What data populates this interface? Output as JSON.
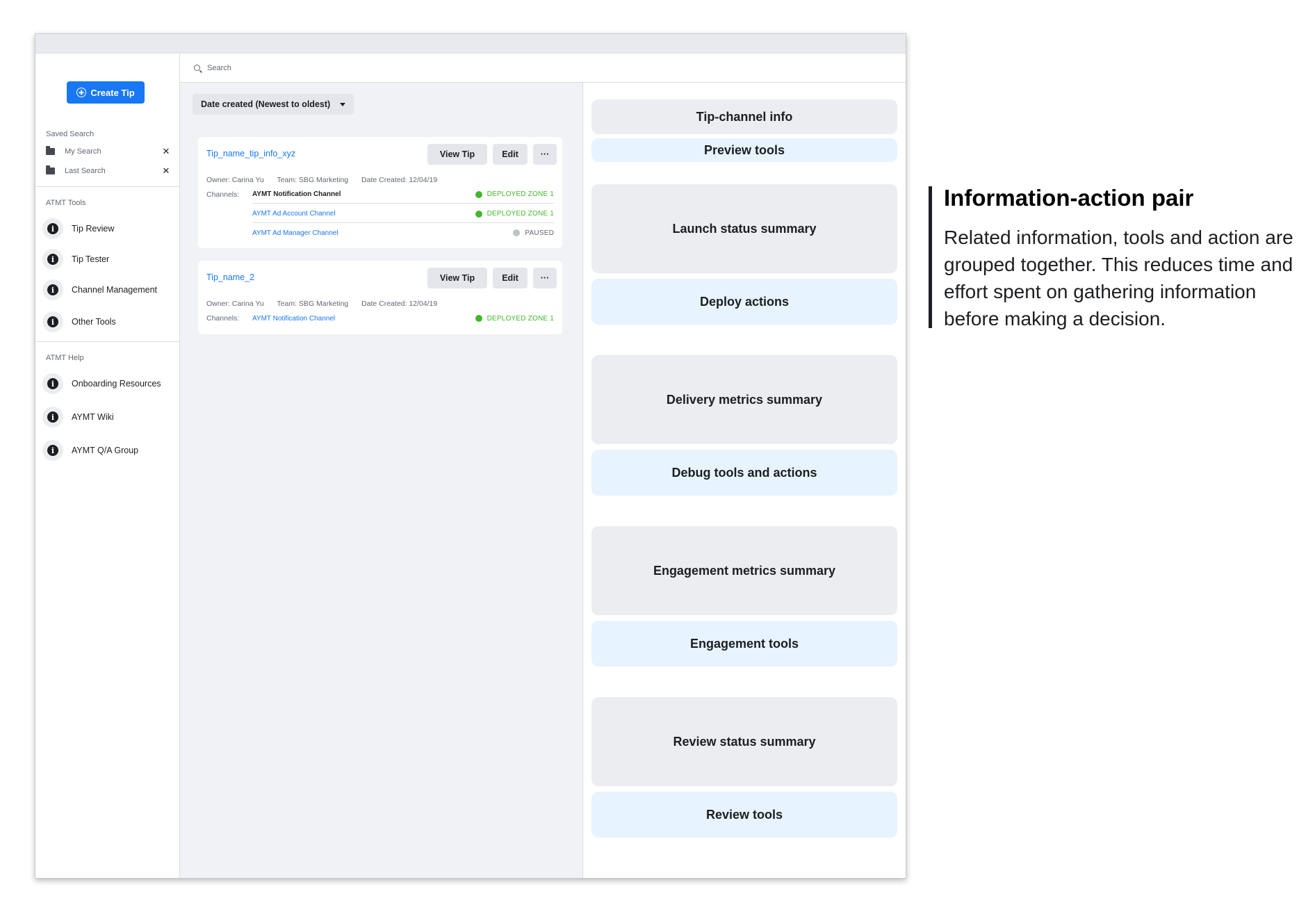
{
  "sidebar": {
    "create_button": "Create Tip",
    "saved_search_label": "Saved Search",
    "saved_searches": [
      {
        "label": "My Search"
      },
      {
        "label": "Last Search"
      }
    ],
    "tools_label": "ATMT Tools",
    "tools": [
      {
        "label": "Tip Review"
      },
      {
        "label": "Tip Tester"
      },
      {
        "label": "Channel Management"
      },
      {
        "label": "Other Tools"
      }
    ],
    "help_label": "ATMT Help",
    "help": [
      {
        "label": "Onboarding Resources"
      },
      {
        "label": "AYMT Wiki"
      },
      {
        "label": "AYMT Q/A Group"
      }
    ],
    "close_glyph": "✕",
    "info_glyph": "i"
  },
  "search": {
    "placeholder": "Search"
  },
  "sort": {
    "label": "Date created (Newest to oldest)"
  },
  "tips": [
    {
      "title": "Tip_name_tip_info_xyz",
      "view_label": "View Tip",
      "edit_label": "Edit",
      "more_label": "···",
      "owner": "Owner: Carina Yu",
      "team": "Team: SBG Marketing",
      "date": "Date Created: 12/04/19",
      "channels_label": "Channels:",
      "channels": [
        {
          "name": "AYMT Notification Channel",
          "status": "DEPLOYED ZONE 1"
        },
        {
          "name": "AYMT Ad Account Channel",
          "status": "DEPLOYED ZONE 1"
        },
        {
          "name": "AYMT Ad Manager Channel",
          "status": "PAUSED"
        }
      ]
    },
    {
      "title": "Tip_name_2",
      "view_label": "View Tip",
      "edit_label": "Edit",
      "more_label": "···",
      "owner": "Owner: Carina Yu",
      "team": "Team: SBG Marketing",
      "date": "Date Created: 12/04/19",
      "channels_label": "Channels:",
      "channels": [
        {
          "name": "AYMT Notification Channel",
          "status": "DEPLOYED ZONE 1"
        }
      ]
    }
  ],
  "status_colors": {
    "deployed": "#42b72a",
    "paused": "#bec3c9"
  },
  "panel_blocks": [
    {
      "label": "Tip-channel info",
      "kind": "info"
    },
    {
      "label": "Preview tools",
      "kind": "action"
    },
    {
      "label": "Launch status summary",
      "kind": "info"
    },
    {
      "label": "Deploy actions",
      "kind": "action"
    },
    {
      "label": "Delivery metrics summary",
      "kind": "info"
    },
    {
      "label": "Debug tools and actions",
      "kind": "action"
    },
    {
      "label": "Engagement metrics summary",
      "kind": "info"
    },
    {
      "label": "Engagement tools",
      "kind": "action"
    },
    {
      "label": "Review status summary",
      "kind": "info"
    },
    {
      "label": "Review tools",
      "kind": "action"
    }
  ],
  "annotation": {
    "title": "Information-action pair",
    "body": "Related information, tools and action are grouped together. This reduces time and effort spent on gathering information before making a decision."
  }
}
